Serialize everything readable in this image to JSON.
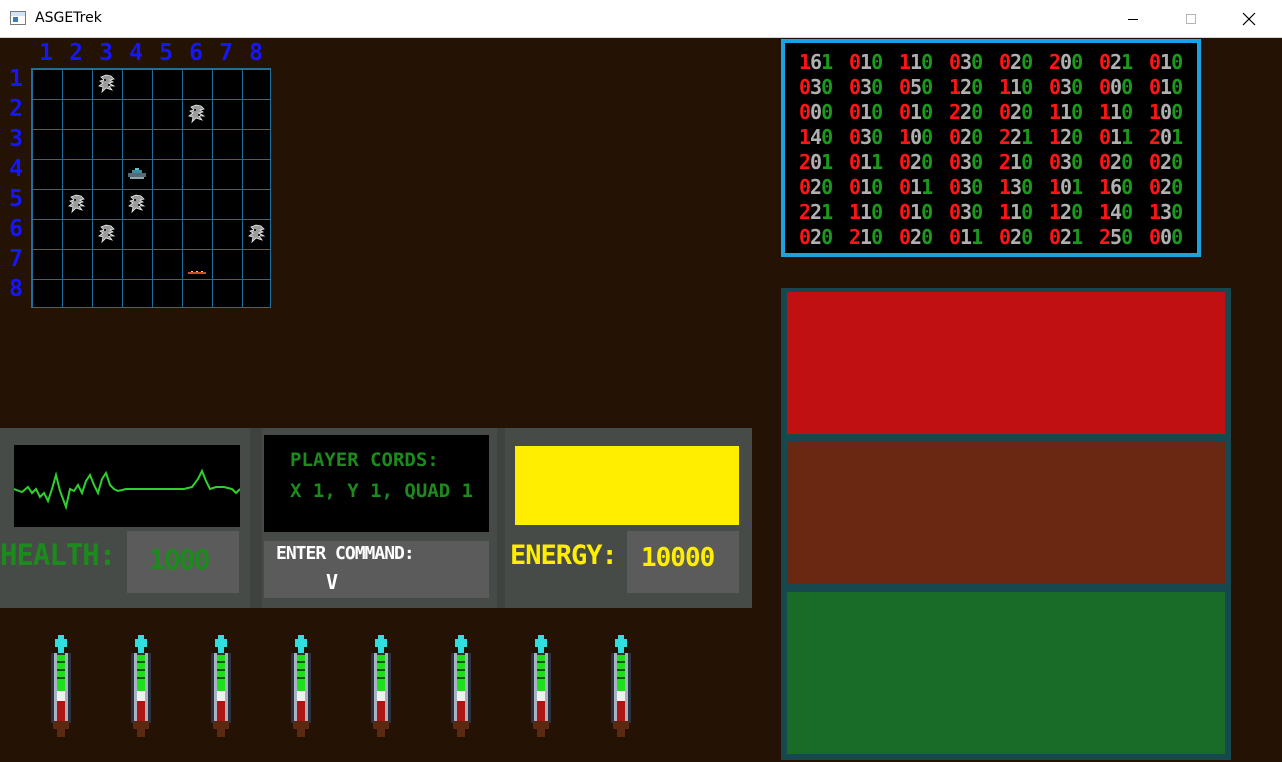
{
  "window": {
    "title": "ASGETrek",
    "controls": {
      "minimize_icon": "minimize-icon",
      "maximize_icon": "maximize-icon",
      "close_icon": "close-icon"
    }
  },
  "sector_map": {
    "column_labels": [
      "1",
      "2",
      "3",
      "4",
      "5",
      "6",
      "7",
      "8"
    ],
    "row_labels": [
      "1",
      "2",
      "3",
      "4",
      "5",
      "6",
      "7",
      "8"
    ],
    "grid_color": "#1b6f9c",
    "objects": [
      {
        "type": "alien-icon",
        "row": 1,
        "col": 3
      },
      {
        "type": "alien-icon",
        "row": 2,
        "col": 6
      },
      {
        "type": "player-ship-icon",
        "row": 4,
        "col": 4
      },
      {
        "type": "alien-icon",
        "row": 5,
        "col": 2
      },
      {
        "type": "alien-icon",
        "row": 5,
        "col": 4
      },
      {
        "type": "alien-icon",
        "row": 6,
        "col": 3
      },
      {
        "type": "alien-icon",
        "row": 6,
        "col": 8
      },
      {
        "type": "starbase-icon",
        "row": 7,
        "col": 6
      }
    ]
  },
  "galaxy_scan": {
    "rows": [
      [
        "161",
        "010",
        "110",
        "030",
        "020",
        "200",
        "021",
        "010"
      ],
      [
        "030",
        "030",
        "050",
        "120",
        "110",
        "030",
        "000",
        "010"
      ],
      [
        "000",
        "010",
        "010",
        "220",
        "020",
        "110",
        "110",
        "100"
      ],
      [
        "140",
        "030",
        "100",
        "020",
        "221",
        "120",
        "011",
        "201"
      ],
      [
        "201",
        "011",
        "020",
        "030",
        "210",
        "030",
        "020",
        "020"
      ],
      [
        "020",
        "010",
        "011",
        "030",
        "130",
        "101",
        "160",
        "020"
      ],
      [
        "221",
        "110",
        "010",
        "030",
        "110",
        "120",
        "140",
        "130"
      ],
      [
        "020",
        "210",
        "020",
        "011",
        "020",
        "021",
        "250",
        "000"
      ]
    ],
    "digit_colors": [
      "#ff1515",
      "#b0b0b0",
      "#1a9a1a"
    ]
  },
  "status_panels": {
    "colors": [
      "#c01012",
      "#6a2711",
      "#196b28"
    ]
  },
  "console": {
    "health_label": "HEALTH:",
    "health_value": "1000",
    "coords_title": "PLAYER CORDS:",
    "coords_value": "X 1, Y 1, QUAD 1",
    "command_label": "ENTER COMMAND:",
    "command_input": "V",
    "energy_label": "ENERGY:",
    "energy_value": "10000",
    "energy_level": 1.0
  },
  "torpedoes": {
    "count": 8,
    "icon": "torpedo-icon"
  }
}
